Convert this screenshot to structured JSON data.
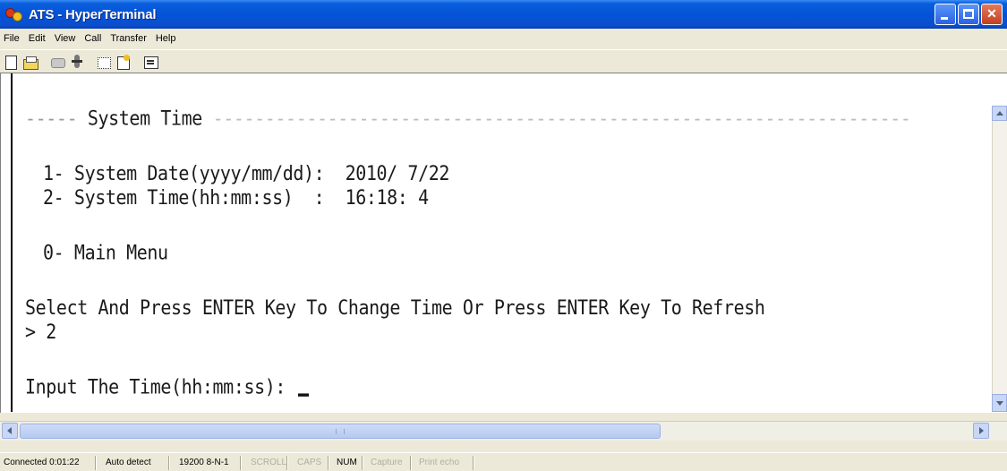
{
  "window": {
    "title": "ATS - HyperTerminal",
    "app_icon": "hyperterminal-icon",
    "controls": [
      "minimize",
      "maximize",
      "close"
    ]
  },
  "menu": {
    "items": [
      "File",
      "Edit",
      "View",
      "Call",
      "Transfer",
      "Help"
    ]
  },
  "toolbar": {
    "icons": [
      "new-icon",
      "open-icon",
      "call-icon",
      "disconnect-icon",
      "send-icon",
      "receive-icon",
      "properties-icon"
    ]
  },
  "terminal": {
    "header_lead": "-----",
    "header_title": " System Time ",
    "header_trail": "-------------------------------------------------------------------",
    "option1": "1- System Date(yyyy/mm/dd):  2010/ 7/22",
    "option2": "2- System Time(hh:mm:ss)  :  16:18: 4",
    "option0": "0- Main Menu",
    "select_prompt": "Select And Press ENTER Key To Change Time Or Press ENTER Key To Refresh",
    "user_input": "> 2",
    "input_prompt": "Input The Time(hh:mm:ss): "
  },
  "statusbar": {
    "connected": "Connected 0:01:22",
    "detect": "Auto detect",
    "port_settings": "19200 8-N-1",
    "scroll": "SCROLL",
    "caps": "CAPS",
    "num": "NUM",
    "capture": "Capture",
    "print_echo": "Print echo"
  },
  "colors": {
    "titlebar": "#0553d8",
    "chrome": "#ece9d8",
    "terminal_bg": "#ffffff",
    "terminal_text": "#1a1a1a"
  }
}
